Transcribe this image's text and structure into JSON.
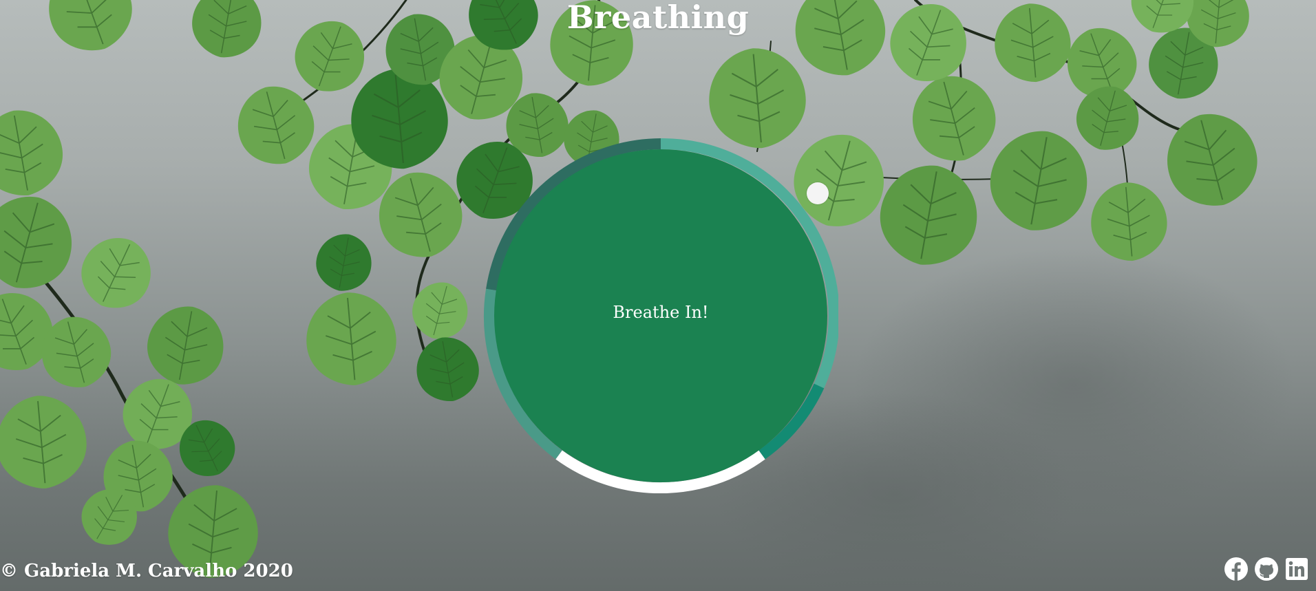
{
  "header": {
    "title": "Breathing"
  },
  "breath": {
    "instruction": "Breathe In!",
    "colors": {
      "circle": "#1b8251",
      "ring_light": "#4fae9a",
      "ring_dark": "#2e6d61",
      "ring_teal": "#138b73",
      "ring_white": "#ffffff",
      "pointer": "#f4f4f4"
    }
  },
  "footer": {
    "copyright": "© Gabriela M. Carvalho 2020",
    "social_icons": [
      "facebook-icon",
      "github-icon",
      "linkedin-icon"
    ]
  },
  "background": {
    "description_icon": "leaves-background",
    "sky_color": "#a7adac",
    "leaf_colors": [
      "#6aa64f",
      "#4f9140",
      "#2f7a2e",
      "#7ab65a"
    ],
    "branch_color": "#1f2a1c"
  }
}
